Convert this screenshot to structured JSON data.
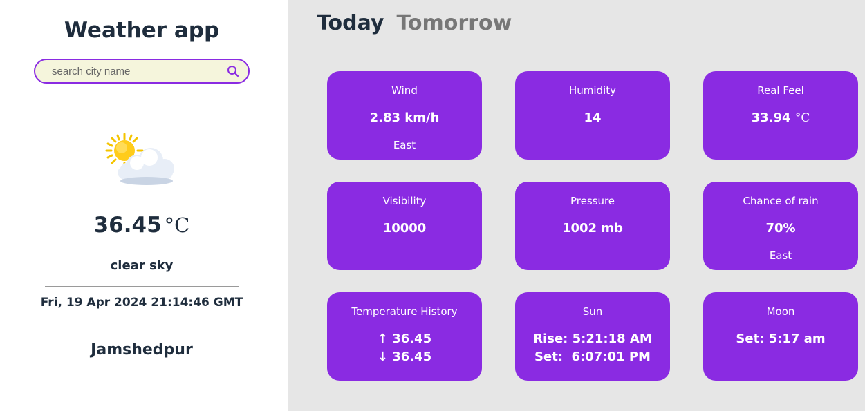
{
  "sidebar": {
    "title": "Weather app",
    "search": {
      "placeholder": "search city name",
      "value": ""
    },
    "weather_icon": "sun-behind-cloud-icon",
    "temperature": "36.45",
    "temperature_unit": "°C",
    "description": "clear sky",
    "datetime": "Fri, 19 Apr 2024 21:14:46 GMT",
    "city": "Jamshedpur"
  },
  "tabs": [
    {
      "label": "Today",
      "active": true
    },
    {
      "label": "Tomorrow",
      "active": false
    }
  ],
  "cards": {
    "wind": {
      "title": "Wind",
      "value": "2.83 km/h",
      "sub": "East"
    },
    "humidity": {
      "title": "Humidity",
      "value": "14"
    },
    "real_feel": {
      "title": "Real Feel",
      "value": "33.94",
      "unit": "°C"
    },
    "visibility": {
      "title": "Visibility",
      "value": "10000"
    },
    "pressure": {
      "title": "Pressure",
      "value": "1002 mb"
    },
    "rain": {
      "title": "Chance of rain",
      "value": "70%",
      "sub": "East"
    },
    "temp_history": {
      "title": "Temperature History",
      "high": "36.45",
      "low": "36.45"
    },
    "sun": {
      "title": "Sun",
      "rise": "Rise: 5:21:18 AM",
      "set": "Set:  6:07:01 PM"
    },
    "moon": {
      "title": "Moon",
      "set": "Set: 5:17 am"
    }
  },
  "colors": {
    "card_bg": "#8a2be2",
    "search_border": "#8a2be2",
    "search_bg": "#f5f5dc",
    "main_bg": "#e6e6e6",
    "text_dark": "#1f2d3d"
  }
}
